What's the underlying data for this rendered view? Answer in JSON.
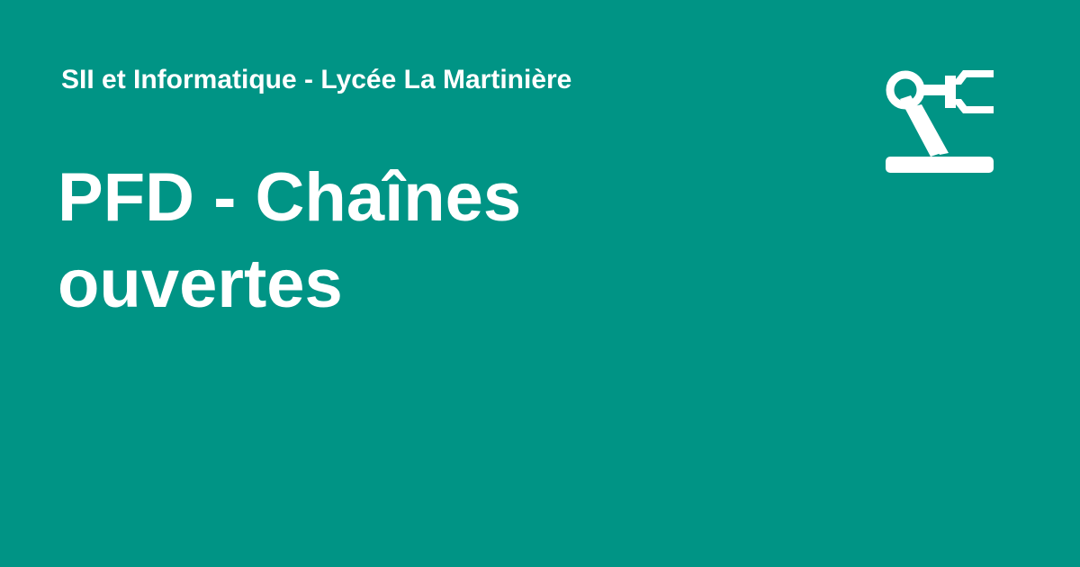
{
  "site": {
    "name": "SII et Informatique - Lycée La Martinière",
    "logo_icon": "robot-arm-icon"
  },
  "page": {
    "title": "PFD - Chaînes ouvertes"
  },
  "colors": {
    "background": "#009485",
    "foreground": "#ffffff"
  }
}
